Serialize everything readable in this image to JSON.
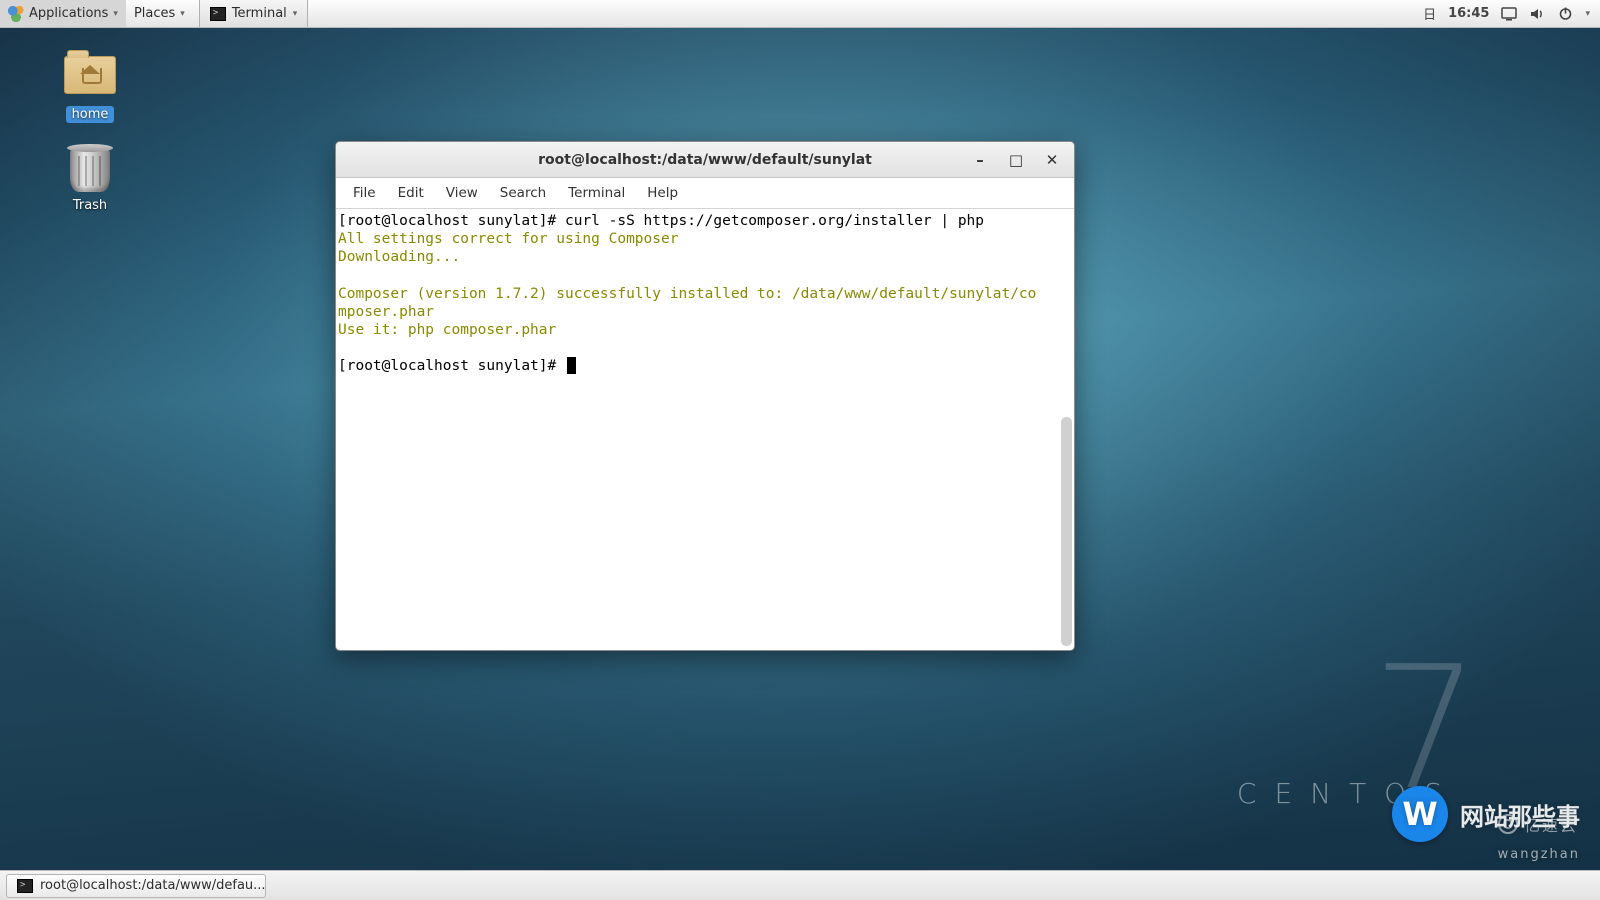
{
  "top_bar": {
    "applications_label": "Applications",
    "places_label": "Places",
    "running_app_label": "Terminal",
    "clock_day": "日",
    "clock_time": "16:45"
  },
  "desktop_icons": {
    "home_label": "home",
    "trash_label": "Trash"
  },
  "branding": {
    "number": "7",
    "name": "CENTOS"
  },
  "watermark": {
    "badge_letter": "W",
    "text": "网站那些事",
    "subtext": "wangzhan",
    "yiyun": "亿速云"
  },
  "terminal": {
    "title": "root@localhost:/data/www/default/sunylat",
    "menu": {
      "file": "File",
      "edit": "Edit",
      "view": "View",
      "search": "Search",
      "terminal": "Terminal",
      "help": "Help"
    },
    "lines": {
      "l1_prompt": "[root@localhost sunylat]# ",
      "l1_cmd": "curl -sS https://getcomposer.org/installer | php",
      "l2": "All settings correct for using Composer",
      "l3": "Downloading...",
      "l4": "",
      "l5": "Composer (version 1.7.2) successfully installed to: /data/www/default/sunylat/co",
      "l6": "mposer.phar",
      "l7": "Use it: php composer.phar",
      "l8": "",
      "l9_prompt": "[root@localhost sunylat]# "
    }
  },
  "bottom_bar": {
    "task_label": "root@localhost:/data/www/defau..."
  }
}
